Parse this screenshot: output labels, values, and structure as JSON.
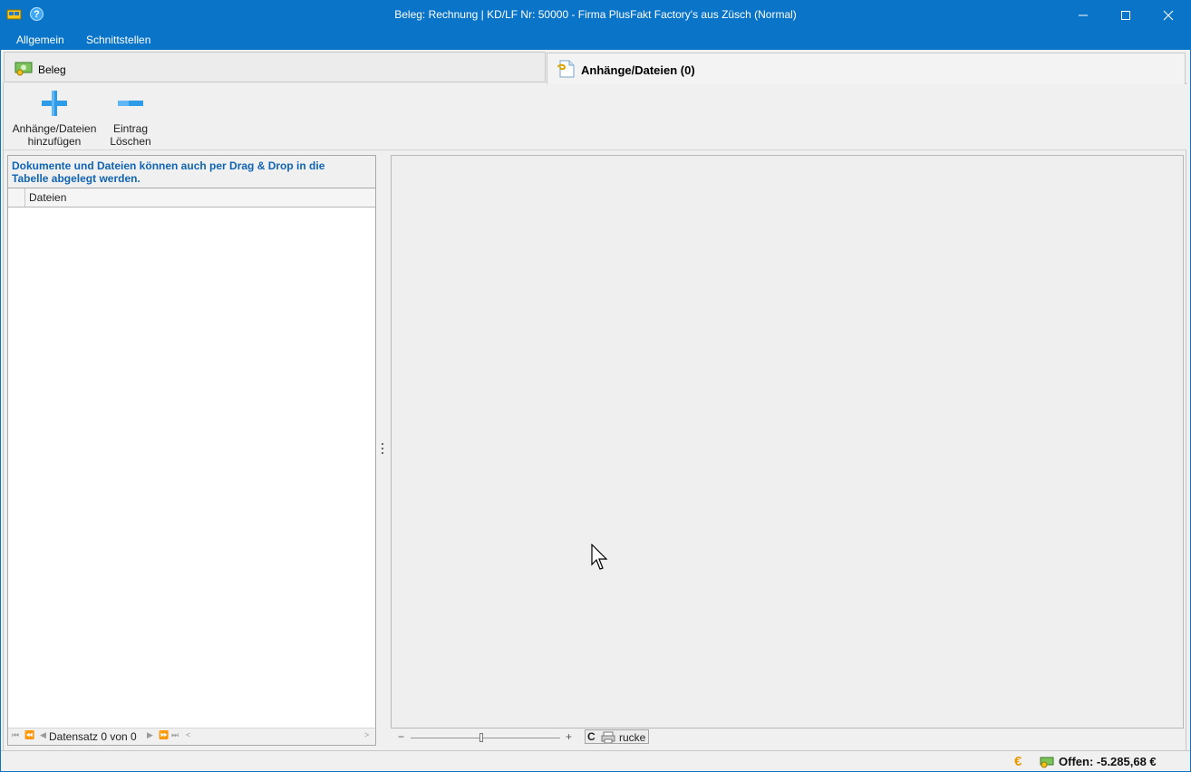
{
  "window": {
    "title": "Beleg: Rechnung |  KD/LF Nr: 50000 - Firma PlusFakt Factory's  aus Züsch (Normal)"
  },
  "menu": {
    "items": [
      "Allgemein",
      "Schnittstellen"
    ]
  },
  "tabs": [
    {
      "label": "Beleg",
      "icon": "money-icon"
    },
    {
      "label": "Anhänge/Dateien (0)",
      "icon": "attachment-icon"
    }
  ],
  "toolbar": {
    "add_label_1": "Anhänge/Dateien",
    "add_label_2": "hinzufügen",
    "delete_label_1": "Eintrag",
    "delete_label_2": "Löschen"
  },
  "left_panel": {
    "info_line_1": "Dokumente und Dateien können auch per Drag & Drop in die",
    "info_line_2": "Tabelle abgelegt werden.",
    "column_header": "Dateien",
    "navigator_text": "Datensatz 0 von 0"
  },
  "viewer": {
    "zoom_minus": "−",
    "zoom_plus": "+",
    "print_label": "rucke"
  },
  "status": {
    "offen": "Offen: -5.285,68 €"
  },
  "colors": {
    "titlebar": "#0a74c9",
    "info_text": "#1064b4",
    "euro": "#e69a00"
  }
}
